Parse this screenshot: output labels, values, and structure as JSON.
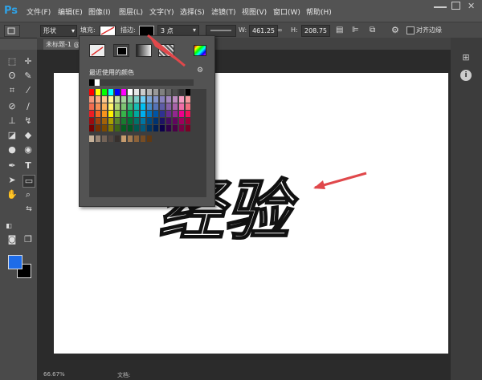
{
  "app": {
    "logo": "Ps"
  },
  "menu": [
    "文件(F)",
    "编辑(E)",
    "图像(I)",
    "图层(L)",
    "文字(Y)",
    "选择(S)",
    "滤镜(T)",
    "视图(V)",
    "窗口(W)",
    "帮助(H)"
  ],
  "options": {
    "mode": "形状",
    "fill_label": "填充:",
    "stroke_label": "描边:",
    "stroke_width": "3 点",
    "w_label": "W:",
    "w_value": "461.25",
    "h_label": "H:",
    "h_value": "208.75",
    "align_edges": "对齐边缘"
  },
  "document": {
    "tab": "未标题-1 @"
  },
  "popup": {
    "recent_label": "最近使用的颜色"
  },
  "canvas": {
    "text": "经验"
  },
  "colors": {
    "foreground": "#1e6ce8",
    "background": "#000000",
    "annotation_arrow": "#e0484b"
  },
  "status": {
    "left": "66.67%",
    "doc": "文档:"
  }
}
